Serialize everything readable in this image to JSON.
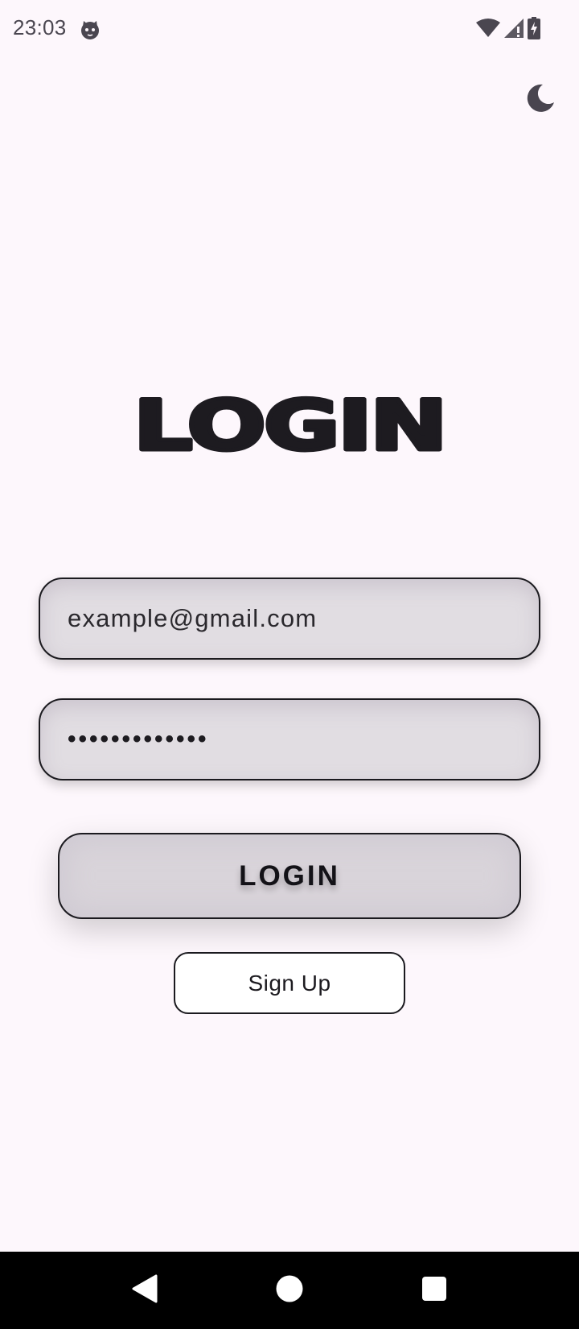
{
  "status_bar": {
    "time": "23:03",
    "icons": [
      "cat-app-icon",
      "wifi-icon",
      "signal-no-data-icon",
      "battery-charging-icon"
    ]
  },
  "theme_toggle": {
    "icon": "moon-icon"
  },
  "title": "LOGIN",
  "form": {
    "email_value": "example@gmail.com",
    "password_masked": "•••••••••••••",
    "login_label": "LOGIN",
    "signup_label": "Sign Up"
  },
  "nav_bar": {
    "icons": [
      "back-icon",
      "home-icon",
      "recents-icon"
    ]
  },
  "colors": {
    "background": "#fdf7fc",
    "field_fill": "#e1dde2",
    "border": "#1b1a1f",
    "nav_bar": "#000000"
  }
}
